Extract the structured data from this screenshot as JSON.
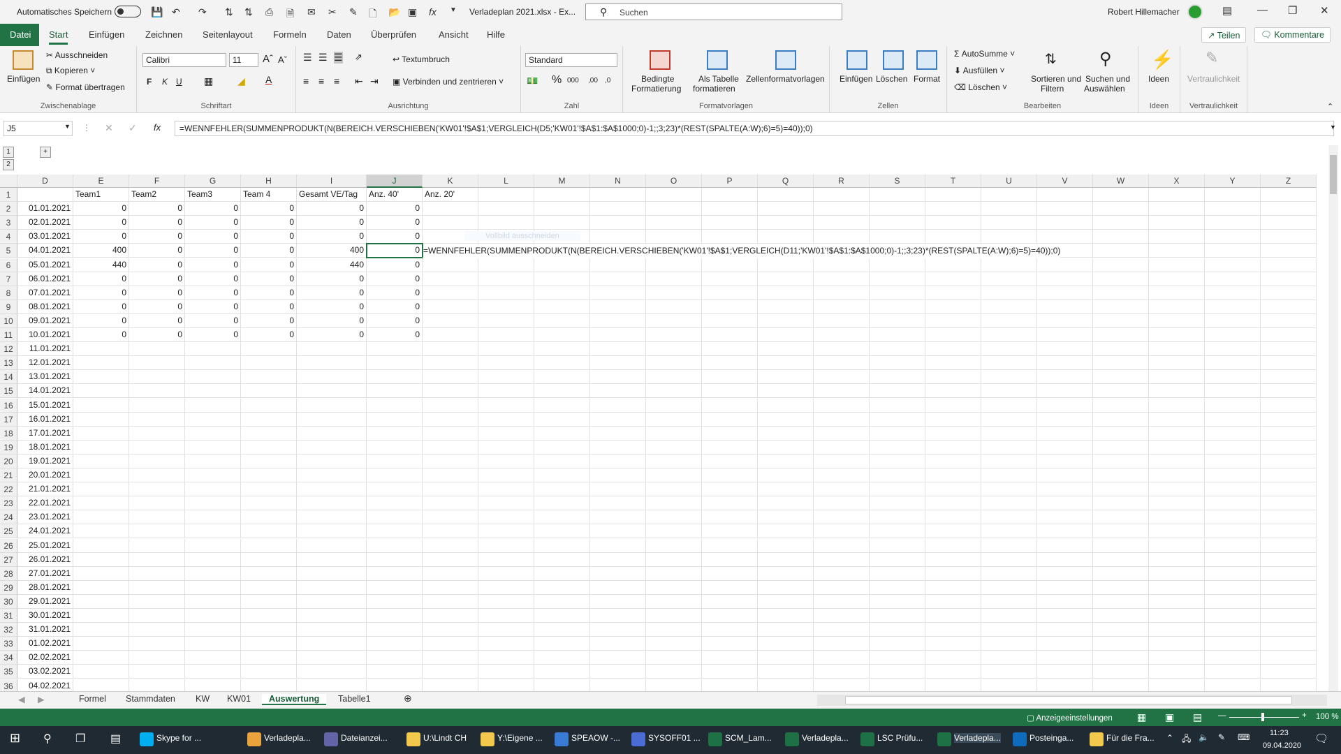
{
  "titlebar": {
    "autosave_label": "Automatisches Speichern",
    "file_title": "Verladeplan 2021.xlsx - Ex...",
    "search_placeholder": "Suchen",
    "user_name": "Robert Hillemacher"
  },
  "tabs": [
    "Datei",
    "Start",
    "Einfügen",
    "Zeichnen",
    "Seitenlayout",
    "Formeln",
    "Daten",
    "Überprüfen",
    "Ansicht",
    "Hilfe"
  ],
  "share_label": "Teilen",
  "comments_label": "Kommentare",
  "ribbon": {
    "clipboard": {
      "paste": "Einfügen",
      "cut": "Ausschneiden",
      "copy": "Kopieren",
      "format_painter": "Format übertragen",
      "group": "Zwischenablage"
    },
    "font": {
      "name": "Calibri",
      "size": "11",
      "bold": "F",
      "italic": "K",
      "underline": "U",
      "group": "Schriftart"
    },
    "alignment": {
      "wrap": "Textumbruch",
      "merge": "Verbinden und zentrieren",
      "group": "Ausrichtung"
    },
    "number": {
      "format": "Standard",
      "group": "Zahl"
    },
    "styles": {
      "conditional": "Bedingte",
      "conditional2": "Formatierung",
      "as_table": "Als Tabelle",
      "as_table2": "formatieren",
      "cell_styles": "Zellenformatvorlagen",
      "group": "Formatvorlagen"
    },
    "cells": {
      "insert": "Einfügen",
      "delete": "Löschen",
      "format": "Format",
      "group": "Zellen"
    },
    "editing": {
      "autosum": "AutoSumme",
      "fill": "Ausfüllen",
      "clear": "Löschen",
      "sort": "Sortieren und",
      "sort2": "Filtern",
      "find": "Suchen und",
      "find2": "Auswählen",
      "group": "Bearbeiten"
    },
    "ideas": {
      "label": "Ideen",
      "group": "Ideen"
    },
    "sensitivity": {
      "label": "Vertraulichkeit",
      "group": "Vertraulichkeit"
    }
  },
  "namebox": "J5",
  "formula": "=WENNFEHLER(SUMMENPRODUKT(N(BEREICH.VERSCHIEBEN('KW01'!$A$1;VERGLEICH(D5;'KW01'!$A$1:$A$1000;0)-1;;3;23)*(REST(SPALTE(A:W);6)=5)=40));0)",
  "spill_formula": "=WENNFEHLER(SUMMENPRODUKT(N(BEREICH.VERSCHIEBEN('KW01'!$A$1;VERGLEICH(D11;'KW01'!$A$1:$A$1000;0)-1;;3;23)*(REST(SPALTE(A:W);6)=5)=40));0)",
  "tooltip_faint": "Vollbild ausschneiden",
  "outline_levels": [
    "1",
    "2"
  ],
  "columns": [
    "D",
    "E",
    "F",
    "G",
    "H",
    "I",
    "J",
    "K",
    "L",
    "M",
    "N",
    "O",
    "P",
    "Q",
    "R",
    "S",
    "T",
    "U",
    "V",
    "W",
    "X",
    "Y",
    "Z"
  ],
  "header_row": [
    "",
    "Team1",
    "Team2",
    "Team3",
    "Team 4",
    "Gesamt VE/Tag",
    "Anz. 40'",
    "Anz. 20'"
  ],
  "rows": [
    [
      "01.01.2021",
      "0",
      "0",
      "0",
      "0",
      "0",
      "0"
    ],
    [
      "02.01.2021",
      "0",
      "0",
      "0",
      "0",
      "0",
      "0"
    ],
    [
      "03.01.2021",
      "0",
      "0",
      "0",
      "0",
      "0",
      "0"
    ],
    [
      "04.01.2021",
      "400",
      "0",
      "0",
      "0",
      "400",
      "0"
    ],
    [
      "05.01.2021",
      "440",
      "0",
      "0",
      "0",
      "440",
      "0"
    ],
    [
      "06.01.2021",
      "0",
      "0",
      "0",
      "0",
      "0",
      "0"
    ],
    [
      "07.01.2021",
      "0",
      "0",
      "0",
      "0",
      "0",
      "0"
    ],
    [
      "08.01.2021",
      "0",
      "0",
      "0",
      "0",
      "0",
      "0"
    ],
    [
      "09.01.2021",
      "0",
      "0",
      "0",
      "0",
      "0",
      "0"
    ],
    [
      "10.01.2021",
      "0",
      "0",
      "0",
      "0",
      "0",
      "0"
    ],
    [
      "11.01.2021"
    ],
    [
      "12.01.2021"
    ],
    [
      "13.01.2021"
    ],
    [
      "14.01.2021"
    ],
    [
      "15.01.2021"
    ],
    [
      "16.01.2021"
    ],
    [
      "17.01.2021"
    ],
    [
      "18.01.2021"
    ],
    [
      "19.01.2021"
    ],
    [
      "20.01.2021"
    ],
    [
      "21.01.2021"
    ],
    [
      "22.01.2021"
    ],
    [
      "23.01.2021"
    ],
    [
      "24.01.2021"
    ],
    [
      "25.01.2021"
    ],
    [
      "26.01.2021"
    ],
    [
      "27.01.2021"
    ],
    [
      "28.01.2021"
    ],
    [
      "29.01.2021"
    ],
    [
      "30.01.2021"
    ],
    [
      "31.01.2021"
    ],
    [
      "01.02.2021"
    ],
    [
      "02.02.2021"
    ],
    [
      "03.02.2021"
    ],
    [
      "04.02.2021"
    ]
  ],
  "sheets": [
    "Formel",
    "Stammdaten",
    "KW",
    "KW01",
    "Auswertung",
    "Tabelle1"
  ],
  "active_sheet": "Auswertung",
  "status": {
    "display_settings": "Anzeigeeinstellungen",
    "zoom": "100 %"
  },
  "taskbar": {
    "items": [
      "Skype for ...",
      "Verladepla...",
      "Dateianzei...",
      "U:\\Lindt CH",
      "Y:\\Eigene ...",
      "SPEAOW -...",
      "SYSOFF01 ...",
      "SCM_Lam...",
      "Verladepla...",
      "LSC Prüfu...",
      "Verladepla...",
      "Posteinga...",
      "Für die Fra..."
    ],
    "time": "11:23",
    "date": "09.04.2020"
  },
  "colors": {
    "accent": "#217346",
    "taskbar": "#1f2a33"
  }
}
